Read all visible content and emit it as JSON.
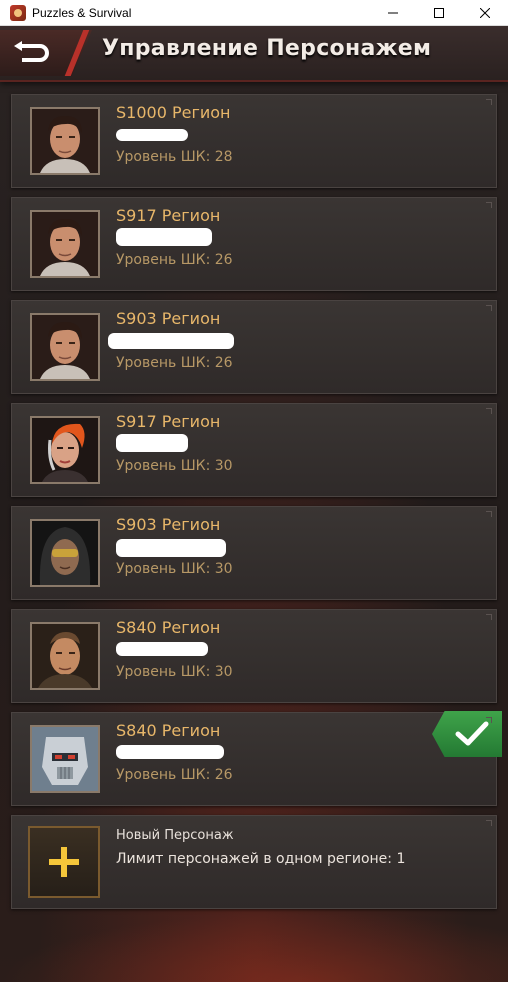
{
  "window": {
    "title": "Puzzles & Survival"
  },
  "header": {
    "title": "Управление Персонажем"
  },
  "characters": [
    {
      "server": "S1000 Регион",
      "level": "Уровень ШК: 28",
      "avatar": "man-portrait-dark-hair",
      "active": false
    },
    {
      "server": "S917 Регион",
      "level": "Уровень ШК: 26",
      "avatar": "man-portrait-dark-hair",
      "active": false
    },
    {
      "server": "S903 Регион",
      "level": "Уровень ШК: 26",
      "avatar": "man-portrait-dark-hair",
      "active": false
    },
    {
      "server": "S917 Регион",
      "level": "Уровень ШК: 30",
      "avatar": "woman-portrait-red-hair",
      "active": false
    },
    {
      "server": "S903 Регион",
      "level": "Уровень ШК: 30",
      "avatar": "hooded-man-goggles",
      "active": false
    },
    {
      "server": "S840 Регион",
      "level": "Уровень ШК: 30",
      "avatar": "man-portrait-short-hair",
      "active": false
    },
    {
      "server": "S840 Регион",
      "level": "Уровень ШК: 26",
      "avatar": "robot-portrait",
      "active": true
    }
  ],
  "new_character": {
    "title": "Новый Персонаж",
    "limit": "Лимит персонажей в одном регионе: 1"
  },
  "colors": {
    "server_text": "#e8b76a",
    "level_text": "#b79866",
    "active_badge": "#3fa34a",
    "plus": "#f5c63a"
  }
}
